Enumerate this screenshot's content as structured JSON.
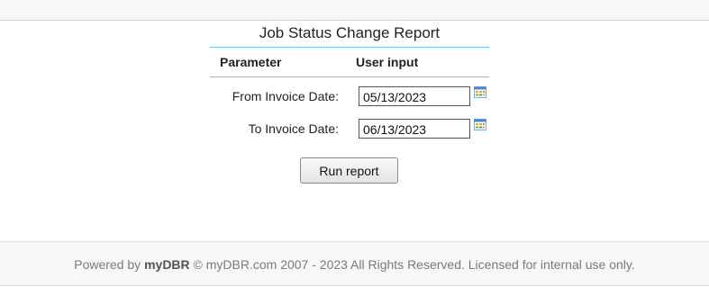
{
  "report": {
    "title": "Job Status Change Report",
    "col_parameter": "Parameter",
    "col_user_input": "User input",
    "params": [
      {
        "label": "From Invoice Date:",
        "value": "05/13/2023"
      },
      {
        "label": "To Invoice Date:",
        "value": "06/13/2023"
      }
    ],
    "run_button": "Run report"
  },
  "footer": {
    "powered_by": "Powered by",
    "brand": "myDBR",
    "rest": "© myDBR.com 2007 - 2023 All Rights Reserved. Licensed for internal use only."
  },
  "icons": {
    "calendar": "calendar-icon"
  },
  "colors": {
    "accent_line": "#6ec6e8",
    "footer_bg": "#f7f7f7"
  }
}
